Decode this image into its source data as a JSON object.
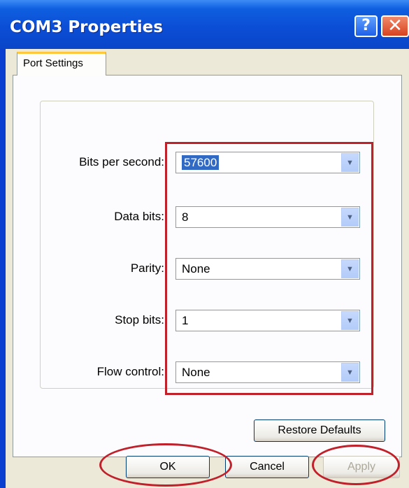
{
  "window": {
    "title": "COM3 Properties",
    "help_label": "?",
    "close_label": "✕"
  },
  "tabs": [
    {
      "label": "Port Settings"
    }
  ],
  "settings": [
    {
      "label": "Bits per second:",
      "value": "57600"
    },
    {
      "label": "Data bits:",
      "value": "8"
    },
    {
      "label": "Parity:",
      "value": "None"
    },
    {
      "label": "Stop bits:",
      "value": "1"
    },
    {
      "label": "Flow control:",
      "value": "None"
    }
  ],
  "buttons": {
    "restore": "Restore Defaults",
    "ok": "OK",
    "cancel": "Cancel",
    "apply": "Apply"
  },
  "colors": {
    "titlebar": "#0b4ed6",
    "annotation": "#c0202a",
    "selection": "#316ac5"
  }
}
